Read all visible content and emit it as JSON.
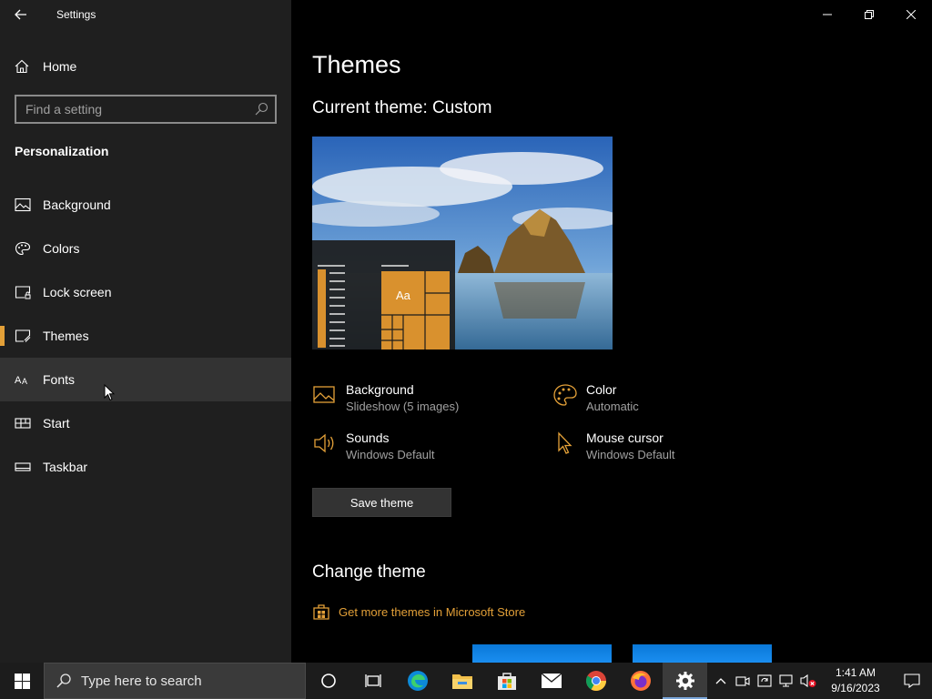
{
  "window": {
    "title": "Settings",
    "controls": [
      "minimize-icon",
      "restore-icon",
      "close-icon"
    ]
  },
  "sidebar": {
    "home_label": "Home",
    "search_placeholder": "Find a setting",
    "section_title": "Personalization",
    "items": [
      {
        "label": "Background",
        "icon": "picture-icon",
        "selected": false
      },
      {
        "label": "Colors",
        "icon": "palette-icon",
        "selected": false
      },
      {
        "label": "Lock screen",
        "icon": "lock-screen-icon",
        "selected": false
      },
      {
        "label": "Themes",
        "icon": "themes-icon",
        "selected": true
      },
      {
        "label": "Fonts",
        "icon": "fonts-icon",
        "selected": false
      },
      {
        "label": "Start",
        "icon": "start-icon",
        "selected": false
      },
      {
        "label": "Taskbar",
        "icon": "taskbar-icon",
        "selected": false
      }
    ]
  },
  "main": {
    "title": "Themes",
    "current_theme": "Current theme: Custom",
    "preview_tile_text": "Aa",
    "attributes": {
      "background": {
        "title": "Background",
        "value": "Slideshow (5 images)"
      },
      "color": {
        "title": "Color",
        "value": "Automatic"
      },
      "sounds": {
        "title": "Sounds",
        "value": "Windows Default"
      },
      "mouse_cursor": {
        "title": "Mouse cursor",
        "value": "Windows Default"
      }
    },
    "save_button": "Save theme",
    "change_theme_title": "Change theme",
    "store_link": "Get more themes in Microsoft Store",
    "accent_color": "#e3a038"
  },
  "taskbar": {
    "search_placeholder": "Type here to search",
    "apps": [
      "task-view-icon",
      "edge-icon",
      "file-explorer-icon",
      "store-icon",
      "mail-icon",
      "chrome-icon",
      "firefox-icon",
      "settings-icon"
    ],
    "active_app": "settings-icon",
    "clock_time": "1:41 AM",
    "clock_date": "9/16/2023"
  }
}
